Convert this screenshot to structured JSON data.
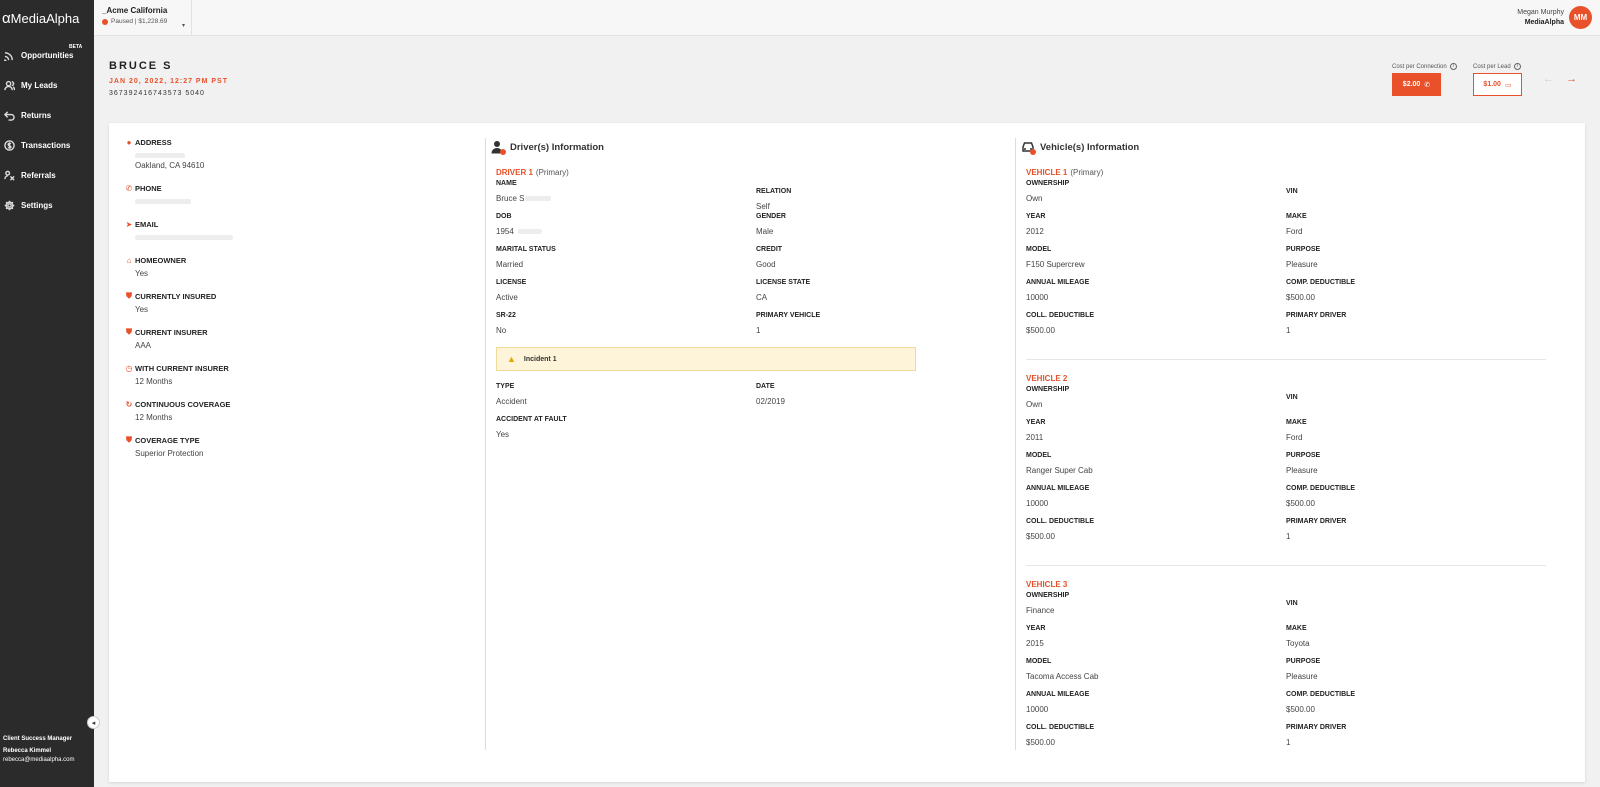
{
  "brand": {
    "name": "MediaAlpha",
    "accent": "#e8512a",
    "sidebar_bg": "#2b2b2b"
  },
  "sidebar": {
    "items": [
      {
        "label": "Opportunities",
        "icon": "signal-icon",
        "badge": "BETA"
      },
      {
        "label": "My Leads",
        "icon": "users-icon"
      },
      {
        "label": "Returns",
        "icon": "return-arrow-icon"
      },
      {
        "label": "Transactions",
        "icon": "dollar-circle-icon"
      },
      {
        "label": "Referrals",
        "icon": "referral-icon"
      },
      {
        "label": "Settings",
        "icon": "gear-icon"
      }
    ],
    "csm": {
      "title": "Client Success Manager",
      "name": "Rebecca Kimmel",
      "email": "rebecca@mediaalpha.com"
    }
  },
  "topbar": {
    "account_name": "_Acme California",
    "account_status": "Paused | $1,228.69",
    "user_name": "Megan Murphy",
    "user_company": "MediaAlpha",
    "avatar_initials": "MM"
  },
  "lead": {
    "name": "BRUCE S",
    "date": "JAN 20, 2022, 12:27 PM PST",
    "id": "367392416743573 5040",
    "cost_per_connection_label": "Cost per Connection",
    "cost_per_connection": "$2.00",
    "cost_per_lead_label": "Cost per Lead",
    "cost_per_lead": "$1.00"
  },
  "contact": [
    {
      "label": "ADDRESS",
      "icon": "map-pin-icon",
      "value": "Oakland, CA 94610"
    },
    {
      "label": "PHONE",
      "icon": "phone-icon",
      "value": ""
    },
    {
      "label": "EMAIL",
      "icon": "send-icon",
      "value": ""
    },
    {
      "label": "HOMEOWNER",
      "icon": "home-icon",
      "value": "Yes"
    },
    {
      "label": "CURRENTLY INSURED",
      "icon": "shield-icon",
      "value": "Yes"
    },
    {
      "label": "CURRENT INSURER",
      "icon": "shield-icon",
      "value": "AAA"
    },
    {
      "label": "WITH CURRENT INSURER",
      "icon": "clock-icon",
      "value": "12 Months"
    },
    {
      "label": "CONTINUOUS COVERAGE",
      "icon": "refresh-icon",
      "value": "12 Months"
    },
    {
      "label": "COVERAGE TYPE",
      "icon": "shield-icon",
      "value": "Superior Protection"
    }
  ],
  "drivers": {
    "heading": "Driver(s) Information",
    "title": "DRIVER 1",
    "primary": "(Primary)",
    "fields": [
      {
        "k": "NAME",
        "v": "Bruce S"
      },
      {
        "k": "RELATION",
        "v": "Self"
      },
      {
        "k": "DOB",
        "v": "1954"
      },
      {
        "k": "GENDER",
        "v": "Male"
      },
      {
        "k": "MARITAL STATUS",
        "v": "Married"
      },
      {
        "k": "CREDIT",
        "v": "Good"
      },
      {
        "k": "LICENSE",
        "v": "Active"
      },
      {
        "k": "LICENSE STATE",
        "v": "CA"
      },
      {
        "k": "SR-22",
        "v": "No"
      },
      {
        "k": "PRIMARY VEHICLE",
        "v": "1"
      }
    ],
    "incident_label": "Incident 1",
    "incident_fields": [
      {
        "k": "TYPE",
        "v": "Accident"
      },
      {
        "k": "DATE",
        "v": "02/2019"
      },
      {
        "k": "ACCIDENT AT FAULT",
        "v": "Yes"
      }
    ]
  },
  "vehicles": {
    "heading": "Vehicle(s) Information",
    "list": [
      {
        "title": "VEHICLE 1",
        "primary": "(Primary)",
        "fields": [
          {
            "k": "OWNERSHIP",
            "v": "Own"
          },
          {
            "k": "VIN",
            "v": ""
          },
          {
            "k": "YEAR",
            "v": "2012"
          },
          {
            "k": "MAKE",
            "v": "Ford"
          },
          {
            "k": "MODEL",
            "v": "F150 Supercrew"
          },
          {
            "k": "PURPOSE",
            "v": "Pleasure"
          },
          {
            "k": "ANNUAL MILEAGE",
            "v": "10000"
          },
          {
            "k": "COMP. DEDUCTIBLE",
            "v": "$500.00"
          },
          {
            "k": "COLL. DEDUCTIBLE",
            "v": "$500.00"
          },
          {
            "k": "PRIMARY DRIVER",
            "v": "1"
          }
        ]
      },
      {
        "title": "VEHICLE 2",
        "primary": "",
        "fields": [
          {
            "k": "OWNERSHIP",
            "v": "Own"
          },
          {
            "k": "VIN",
            "v": ""
          },
          {
            "k": "YEAR",
            "v": "2011"
          },
          {
            "k": "MAKE",
            "v": "Ford"
          },
          {
            "k": "MODEL",
            "v": "Ranger Super Cab"
          },
          {
            "k": "PURPOSE",
            "v": "Pleasure"
          },
          {
            "k": "ANNUAL MILEAGE",
            "v": "10000"
          },
          {
            "k": "COMP. DEDUCTIBLE",
            "v": "$500.00"
          },
          {
            "k": "COLL. DEDUCTIBLE",
            "v": "$500.00"
          },
          {
            "k": "PRIMARY DRIVER",
            "v": "1"
          }
        ]
      },
      {
        "title": "VEHICLE 3",
        "primary": "",
        "fields": [
          {
            "k": "OWNERSHIP",
            "v": "Finance"
          },
          {
            "k": "VIN",
            "v": ""
          },
          {
            "k": "YEAR",
            "v": "2015"
          },
          {
            "k": "MAKE",
            "v": "Toyota"
          },
          {
            "k": "MODEL",
            "v": "Tacoma Access Cab"
          },
          {
            "k": "PURPOSE",
            "v": "Pleasure"
          },
          {
            "k": "ANNUAL MILEAGE",
            "v": "10000"
          },
          {
            "k": "COMP. DEDUCTIBLE",
            "v": "$500.00"
          },
          {
            "k": "COLL. DEDUCTIBLE",
            "v": "$500.00"
          },
          {
            "k": "PRIMARY DRIVER",
            "v": "1"
          }
        ]
      }
    ]
  }
}
